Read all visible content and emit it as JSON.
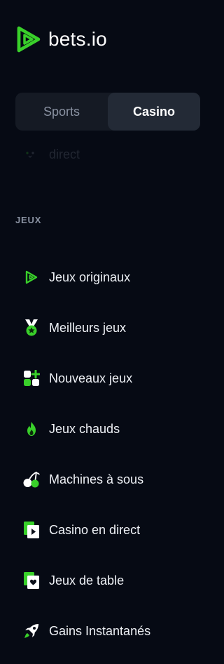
{
  "brand": {
    "name": "bets.io"
  },
  "colors": {
    "accent": "#39d02a",
    "background": "#060a14",
    "switch_bg": "#151a24",
    "switch_active": "#232a36",
    "muted": "#8a92a2"
  },
  "tabs": [
    {
      "label": "Sports",
      "active": false
    },
    {
      "label": "Casino",
      "active": true
    }
  ],
  "partial_item": {
    "label": "direct",
    "icon": "live-icon"
  },
  "section": {
    "title": "JEUX"
  },
  "menu": [
    {
      "label": "Jeux originaux",
      "icon": "bets-logo-icon"
    },
    {
      "label": "Meilleurs jeux",
      "icon": "medal-icon"
    },
    {
      "label": "Nouveaux jeux",
      "icon": "new-games-icon"
    },
    {
      "label": "Jeux chauds",
      "icon": "fire-icon"
    },
    {
      "label": "Machines à sous",
      "icon": "cherries-icon"
    },
    {
      "label": "Casino en direct",
      "icon": "live-casino-icon"
    },
    {
      "label": "Jeux de table",
      "icon": "cards-icon"
    },
    {
      "label": "Gains Instantanés",
      "icon": "rocket-icon"
    }
  ]
}
